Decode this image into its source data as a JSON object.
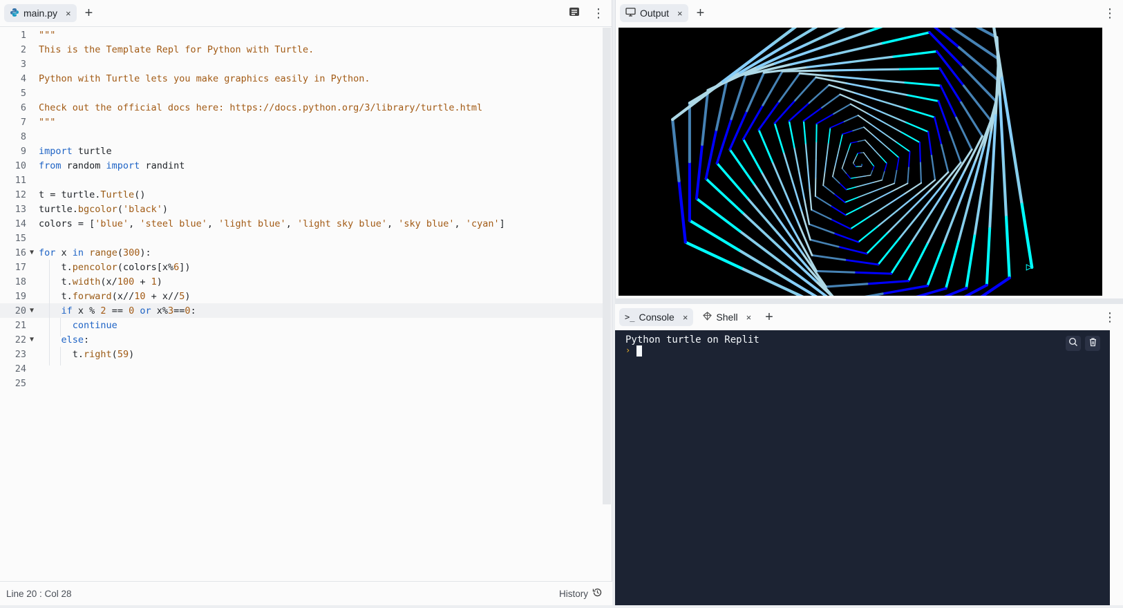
{
  "editor": {
    "tab_label": "main.py",
    "tab_close": "×",
    "plus": "+",
    "status_position": "Line 20 : Col 28",
    "history_label": "History",
    "lines": [
      {
        "n": "1",
        "html": "<span class='str'>\"\"\"</span>"
      },
      {
        "n": "2",
        "html": "<span class='str'>This is the Template Repl for Python with Turtle.</span>"
      },
      {
        "n": "3",
        "html": ""
      },
      {
        "n": "4",
        "html": "<span class='str'>Python with Turtle lets you make graphics easily in Python.</span>"
      },
      {
        "n": "5",
        "html": ""
      },
      {
        "n": "6",
        "html": "<span class='str'>Check out the official docs here: https://docs.python.org/3/library/turtle.html</span>"
      },
      {
        "n": "7",
        "html": "<span class='str'>\"\"\"</span>"
      },
      {
        "n": "8",
        "html": ""
      },
      {
        "n": "9",
        "html": "<span class='kw'>import</span> turtle"
      },
      {
        "n": "10",
        "html": "<span class='kw'>from</span> random <span class='kw'>import</span> randint"
      },
      {
        "n": "11",
        "html": ""
      },
      {
        "n": "12",
        "html": "t = turtle.<span class='fn'>Turtle</span>()"
      },
      {
        "n": "13",
        "html": "turtle.<span class='fn'>bgcolor</span>(<span class='str'>'black'</span>)"
      },
      {
        "n": "14",
        "html": "colors = [<span class='str'>'blue'</span>, <span class='str'>'steel blue'</span>, <span class='str'>'light blue'</span>, <span class='str'>'light sky blue'</span>, <span class='str'>'sky blue'</span>, <span class='str'>'cyan'</span>]"
      },
      {
        "n": "15",
        "html": ""
      },
      {
        "n": "16",
        "fold": "▼",
        "html": "<span class='kw'>for</span> x <span class='kw'>in</span> <span class='fn'>range</span>(<span class='num'>300</span>):"
      },
      {
        "n": "17",
        "html": "    t.<span class='fn'>pencolor</span>(colors[x%<span class='num'>6</span>])"
      },
      {
        "n": "18",
        "html": "    t.<span class='fn'>width</span>(x/<span class='num'>100</span> + <span class='num'>1</span>)"
      },
      {
        "n": "19",
        "html": "    t.<span class='fn'>forward</span>(x//<span class='num'>10</span> + x//<span class='num'>5</span>)"
      },
      {
        "n": "20",
        "fold": "▼",
        "active": true,
        "html": "    <span class='kw'>if</span> x % <span class='num'>2</span> == <span class='num'>0</span> <span class='kw'>or</span> x%<span class='num'>3</span>==<span class='num'>0</span>:"
      },
      {
        "n": "21",
        "html": "      <span class='kw'>continue</span>"
      },
      {
        "n": "22",
        "fold": "▼",
        "html": "    <span class='kw'>else</span>:"
      },
      {
        "n": "23",
        "html": "      t.<span class='fn'>right</span>(<span class='num'>59</span>)"
      },
      {
        "n": "24",
        "html": ""
      },
      {
        "n": "25",
        "html": ""
      }
    ]
  },
  "output": {
    "tab_label": "Output",
    "tab_close": "×",
    "plus": "+"
  },
  "console": {
    "tabs": [
      {
        "label": "Console",
        "close": "×"
      },
      {
        "label": "Shell",
        "close": "×"
      }
    ],
    "plus": "+",
    "text": "Python turtle on Replit",
    "prompt": "›"
  },
  "colors": {
    "turtle": [
      "#0000ff",
      "#4682b4",
      "#add8e6",
      "#87cefa",
      "#87ceeb",
      "#00ffff"
    ]
  }
}
